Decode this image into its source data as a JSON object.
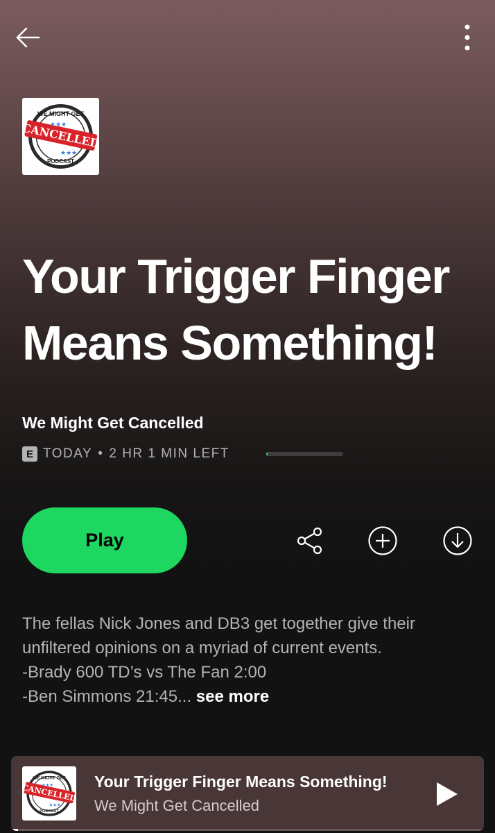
{
  "header": {
    "back_icon": "arrow-left-icon",
    "more_icon": "more-vertical-icon"
  },
  "cover": {
    "art_text_top": "WE MIGHT GET",
    "art_text_banner": "CANCELLED",
    "art_text_bottom": "PODCAST",
    "banner_color": "#d8232a"
  },
  "episode": {
    "title": "Your Trigger Finger Means Something!",
    "show_name": "We Might Get Cancelled",
    "explicit_badge": "E",
    "date": "TODAY",
    "separator": "•",
    "time_left": "2 HR 1 MIN LEFT",
    "progress_fraction": 0.02
  },
  "actions": {
    "play_label": "Play",
    "share_icon": "share-icon",
    "add_icon": "add-circle-icon",
    "download_icon": "download-circle-icon"
  },
  "description": {
    "line1": "The fellas Nick Jones and DB3 get together give their unfiltered opinions on a myriad of current events.",
    "line2": "-Brady 600 TD’s vs The Fan 2:00",
    "line3": "-Ben Simmons 21:45...",
    "see_more": "see more"
  },
  "mini_player": {
    "title": "Your Trigger Finger Means Something!",
    "show": "We Might Get Cancelled",
    "play_icon": "play-icon",
    "progress_fraction": 0.015
  },
  "colors": {
    "accent_green": "#1ed760",
    "background": "#121212",
    "mini_player_bg": "#493636"
  }
}
